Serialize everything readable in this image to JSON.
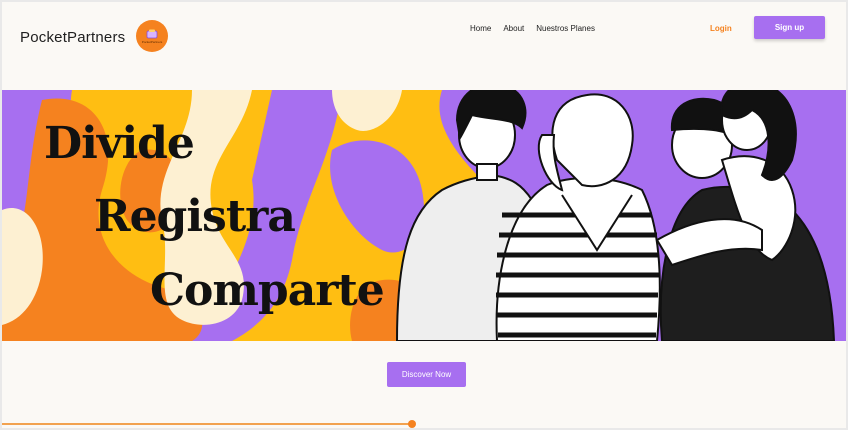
{
  "header": {
    "brand": "PocketPartners",
    "logo_text": "PocketPartners",
    "nav": [
      "Home",
      "About",
      "Nuestros Planes"
    ],
    "login": "Login",
    "signup": "Sign up"
  },
  "hero": {
    "words": [
      "Divide",
      "Registra",
      "Comparte"
    ],
    "cta": "Discover Now"
  },
  "colors": {
    "accent_purple": "#a76ff0",
    "accent_orange": "#f5821f",
    "hero_yellow": "#ffbe12",
    "hero_cream": "#fdf0d2"
  },
  "progress": {
    "value_percent": 48
  }
}
